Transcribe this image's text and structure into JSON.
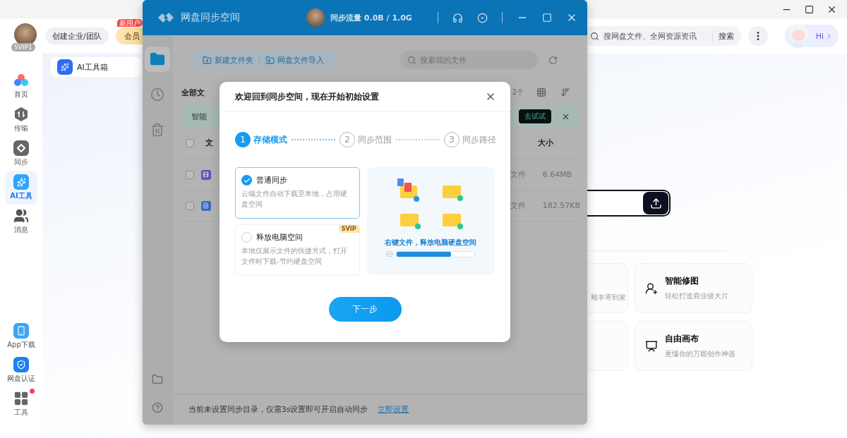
{
  "main_window": {
    "account": {
      "badge": "SVIP1"
    },
    "team_button": "创建企业/团队",
    "member_button": {
      "label": "会员",
      "tag": "新用户"
    },
    "search": {
      "placeholder": "搜网盘文件、全网资源资讯",
      "button": "搜索"
    },
    "assistant": {
      "label": "Hi"
    },
    "nav": [
      {
        "label": "首页",
        "kind": "home",
        "selected": false
      },
      {
        "label": "传输",
        "kind": "transfer",
        "selected": false
      },
      {
        "label": "同步",
        "kind": "sync",
        "selected": false
      },
      {
        "label": "AI工具",
        "kind": "ai",
        "selected": true
      },
      {
        "label": "消息",
        "kind": "users",
        "selected": false
      }
    ],
    "bottom_nav": [
      {
        "label": "App下载",
        "kind": "phone",
        "dot": false
      },
      {
        "label": "网盘认证",
        "kind": "shield",
        "dot": false
      },
      {
        "label": "工具",
        "kind": "grid",
        "dot": true
      }
    ],
    "tab": {
      "label": "AI工具箱"
    },
    "tool_cards": [
      {
        "kind": "partial",
        "desc": "顺丰寄到家"
      },
      {
        "kind": "portrait",
        "title": "智能修图",
        "desc": "轻松打造商业级大片"
      },
      {
        "kind": "partial"
      },
      {
        "kind": "easel",
        "title": "自由画布",
        "desc": "更懂你的万能创作神器"
      }
    ]
  },
  "sync_window": {
    "title": "网盘同步空间",
    "traffic": "同步流量 0.0B / 1.0G",
    "rail": [
      {
        "kind": "folder",
        "selected": true
      },
      {
        "kind": "clock",
        "selected": false
      },
      {
        "kind": "trash",
        "selected": false
      }
    ],
    "toolbar": [
      {
        "label": "新建文件夹",
        "kind": "new-folder"
      },
      {
        "label": "网盘文件导入",
        "kind": "import"
      }
    ],
    "search": {
      "placeholder": "搜索我的文件"
    },
    "breadcrumb": "全部文",
    "count": "2个",
    "banner": {
      "text": "智能",
      "button": "去试试"
    },
    "select_all_checked": false,
    "columns": [
      "文",
      "大小"
    ],
    "rows": [
      {
        "kind": "video",
        "type": "文件",
        "size": "6.64MB",
        "checked": false
      },
      {
        "kind": "word",
        "type": "文件",
        "size": "182.57KB",
        "checked": false
      }
    ],
    "footer": {
      "text": "当前未设置同步目录，仅需3s设置即可开启自动同步",
      "link": "立即设置"
    }
  },
  "dialog": {
    "title": "欢迎回到同步空间，现在开始初始设置",
    "steps": [
      {
        "number": "1",
        "label": "存储模式",
        "selected": true
      },
      {
        "number": "2",
        "label": "同步范围",
        "selected": false
      },
      {
        "number": "3",
        "label": "同步路径",
        "selected": false
      }
    ],
    "options": [
      {
        "title": "普通同步",
        "desc": "云端文件自动下载至本地，占用硬盘空间",
        "selected": true
      },
      {
        "title": "释放电脑空间",
        "desc": "本地仅展示文件的快捷方式，打开文件时下载-节约硬盘空间",
        "selected": false,
        "badge": "SVIP"
      }
    ],
    "illustration": {
      "caption": "右键文件，释放电脑硬盘空间",
      "level": 0.7
    },
    "next_button": "下一步"
  }
}
